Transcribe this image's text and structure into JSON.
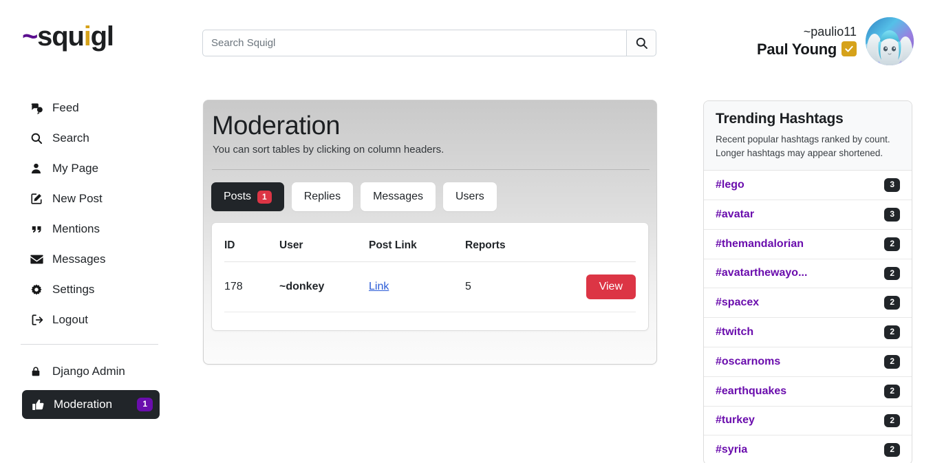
{
  "brand": {
    "logo_tilde": "~",
    "logo_part1": "squ",
    "logo_part_gold": "i",
    "logo_part2": "gl"
  },
  "search": {
    "placeholder": "Search Squigl",
    "value": "",
    "button_icon": "search-icon"
  },
  "user": {
    "handle": "~paulio11",
    "display_name": "Paul Young",
    "verified": true,
    "verified_color": "#d6a21a",
    "avatar_alt": "user-avatar"
  },
  "sidebar": {
    "items": [
      {
        "label": "Feed",
        "icon": "comments-icon"
      },
      {
        "label": "Search",
        "icon": "search-icon"
      },
      {
        "label": "My Page",
        "icon": "user-icon"
      },
      {
        "label": "New Post",
        "icon": "edit-icon"
      },
      {
        "label": "Mentions",
        "icon": "quote-icon"
      },
      {
        "label": "Messages",
        "icon": "envelope-icon"
      },
      {
        "label": "Settings",
        "icon": "gear-icon"
      },
      {
        "label": "Logout",
        "icon": "logout-icon"
      }
    ],
    "bottom_items": [
      {
        "label": "Django Admin",
        "icon": "lock-icon",
        "active": false,
        "badge": ""
      },
      {
        "label": "Moderation",
        "icon": "thumbs-up-icon",
        "active": true,
        "badge": "1"
      }
    ],
    "active_badge_color": "#6a0dad"
  },
  "main": {
    "title": "Moderation",
    "subtitle": "You can sort tables by clicking on column headers.",
    "tabs": [
      {
        "label": "Posts",
        "badge": "1",
        "active": true
      },
      {
        "label": "Replies",
        "badge": "",
        "active": false
      },
      {
        "label": "Messages",
        "badge": "",
        "active": false
      },
      {
        "label": "Users",
        "badge": "",
        "active": false
      }
    ],
    "tab_badge_color": "#dc3545",
    "table": {
      "headers": [
        "ID",
        "User",
        "Post Link",
        "Reports",
        ""
      ],
      "rows": [
        {
          "id": "178",
          "user": "~donkey",
          "post_link_label": "Link",
          "reports": "5",
          "action_label": "View"
        }
      ],
      "action_color": "#dc3545"
    }
  },
  "trending": {
    "title": "Trending Hashtags",
    "subtitle_line1": "Recent popular hashtags ranked by count.",
    "subtitle_line2": "Longer hashtags may appear shortened.",
    "tag_color": "#6a0dad",
    "count_badge_color": "#212529",
    "tags": [
      {
        "name": "#lego",
        "count": "3"
      },
      {
        "name": "#avatar",
        "count": "3"
      },
      {
        "name": "#themandalorian",
        "count": "2"
      },
      {
        "name": "#avatarthewayo...",
        "count": "2"
      },
      {
        "name": "#spacex",
        "count": "2"
      },
      {
        "name": "#twitch",
        "count": "2"
      },
      {
        "name": "#oscarnoms",
        "count": "2"
      },
      {
        "name": "#earthquakes",
        "count": "2"
      },
      {
        "name": "#turkey",
        "count": "2"
      },
      {
        "name": "#syria",
        "count": "2"
      }
    ]
  }
}
